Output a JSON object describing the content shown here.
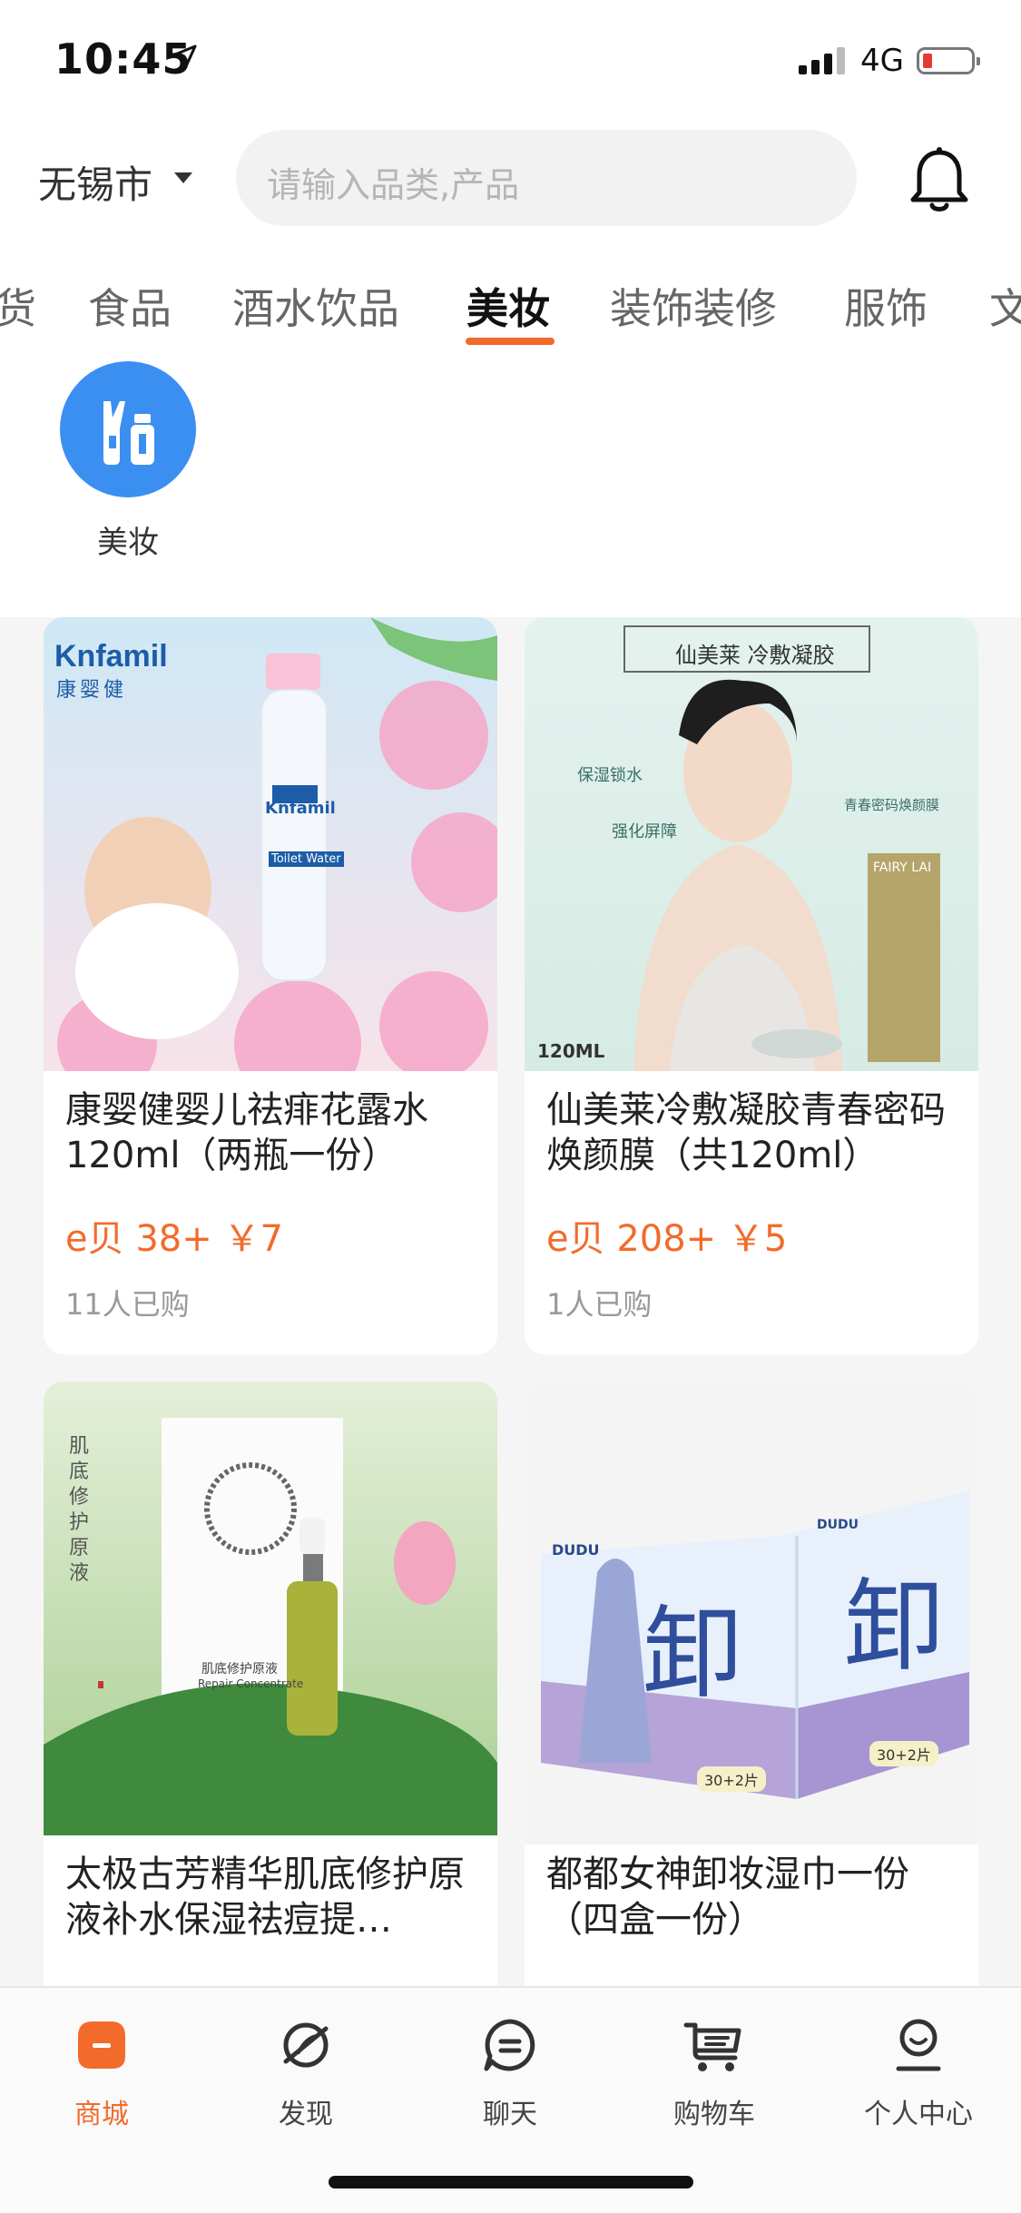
{
  "status_bar": {
    "time": "10:45",
    "network": "4G"
  },
  "header": {
    "city": "无锡市",
    "search_placeholder": "请输入品类,产品"
  },
  "categories": {
    "items": [
      "货",
      "食品",
      "酒水饮品",
      "美妆",
      "装饰装修",
      "服饰",
      "文"
    ],
    "active": "美妆"
  },
  "subcategory": {
    "label": "美妆",
    "icon": "cosmetics-icon"
  },
  "products": [
    {
      "title": "康婴健婴儿祛痱花露水120ml（两瓶一份）",
      "price": "e贝 38+ ￥7",
      "sold": "11人已购",
      "image_text": {
        "brand": "Knfamil",
        "brand_cn": "康婴健",
        "bottle_brand": "Knfamil",
        "bottle_label": "Toilet Water"
      }
    },
    {
      "title": "仙美莱冷敷凝胶青春密码焕颜膜（共120ml）",
      "price": "e贝 208+ ￥5",
      "sold": "1人已购",
      "image_text": {
        "banner": "仙美莱 冷敷凝胶",
        "tag1": "保湿锁水",
        "tag2": "强化屏障",
        "tag3": "青春密码焕颜膜",
        "volume": "120ML",
        "box": "FAIRY LAI"
      }
    },
    {
      "title": "太极古芳精华肌底修护原液补水保湿祛痘提…",
      "price": "",
      "sold": "",
      "image_text": {
        "vertical": "肌底修护原液",
        "product_line": "肌底修护原液",
        "product_en": "Repair Concentrate"
      }
    },
    {
      "title": "都都女神卸妆湿巾一份（四盒一份）",
      "price": "",
      "sold": "",
      "image_text": {
        "brand": "DUDU",
        "glyph": "卸",
        "count": "30+2片"
      }
    }
  ],
  "tabbar": {
    "items": [
      {
        "label": "商城",
        "icon": "shop-icon"
      },
      {
        "label": "发现",
        "icon": "discover-icon"
      },
      {
        "label": "聊天",
        "icon": "chat-icon"
      },
      {
        "label": "购物车",
        "icon": "cart-icon"
      },
      {
        "label": "个人中心",
        "icon": "profile-icon"
      }
    ],
    "active": "商城"
  },
  "colors": {
    "accent": "#f26b2b",
    "subcategory_icon_bg": "#3b8ff0",
    "battery_low": "#e53935"
  }
}
